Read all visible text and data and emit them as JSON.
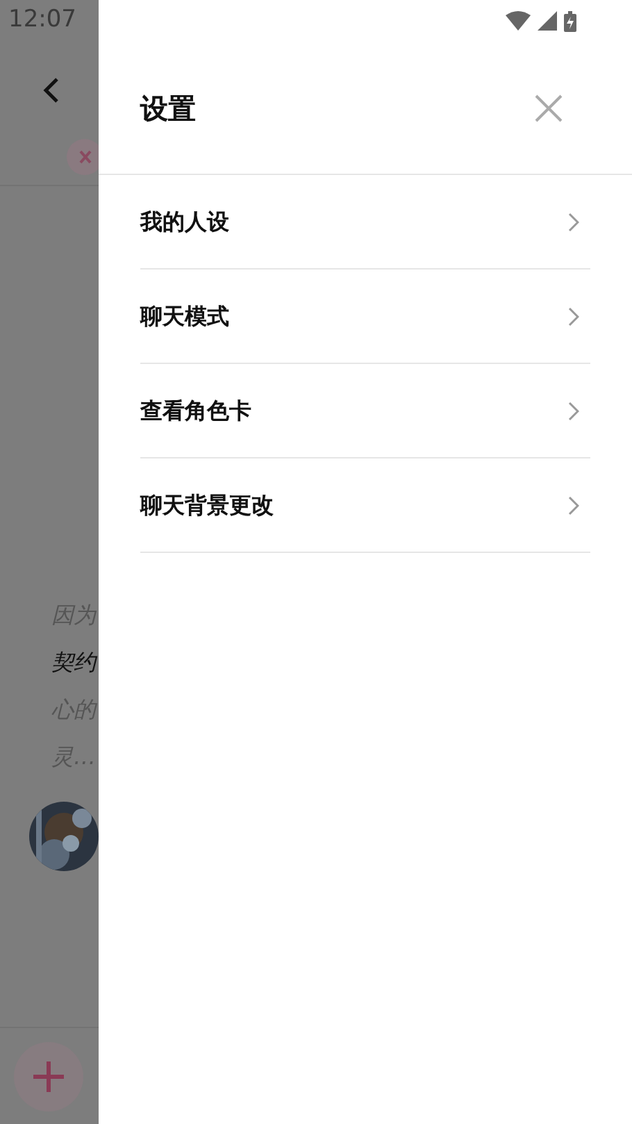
{
  "status_bar": {
    "time": "12:07"
  },
  "background_chat": {
    "lines": [
      {
        "text": "因为",
        "emphasis": false
      },
      {
        "text": "契约",
        "emphasis": true
      },
      {
        "text": "心的",
        "emphasis": false
      },
      {
        "text": "灵…",
        "emphasis": false
      }
    ]
  },
  "drawer": {
    "title": "设置",
    "items": [
      {
        "label": "我的人设"
      },
      {
        "label": "聊天模式"
      },
      {
        "label": "查看角色卡"
      },
      {
        "label": "聊天背景更改"
      }
    ]
  }
}
